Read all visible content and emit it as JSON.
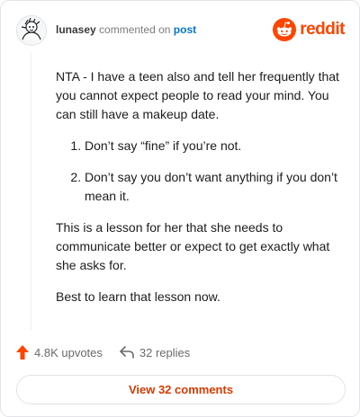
{
  "header": {
    "username": "lunasey",
    "action_text": "commented on",
    "post_link": "post",
    "brand": "reddit"
  },
  "comment": {
    "paragraph_1": "NTA - I have a teen also and tell her frequently that you cannot expect people to read your mind. You can still have a makeup date.",
    "list_items": [
      "Don’t say “fine” if you’re not.",
      "Don’t say you don’t want anything if you don’t mean it."
    ],
    "paragraph_2": "This is a lesson for her that she needs to communicate better or expect to get exactly what she asks for.",
    "paragraph_3": "Best to learn that lesson now."
  },
  "actions": {
    "upvotes": "4.8K upvotes",
    "replies": "32 replies"
  },
  "footer": {
    "view_button": "View 32 comments"
  },
  "colors": {
    "accent": "#ff4500",
    "link": "#0079d3",
    "button_text": "#d93a00"
  },
  "icons": {
    "avatar": "snoo-avatar-icon",
    "brand": "reddit-logo-icon",
    "upvote": "upvote-arrow-icon",
    "reply": "reply-arrow-icon"
  }
}
